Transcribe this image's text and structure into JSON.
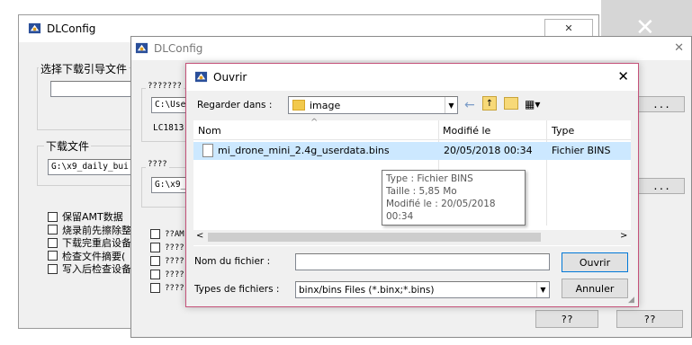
{
  "bg_window1": {
    "title": "DLConfig",
    "group1_label": "选择下载引导文件",
    "group2_label": "下载文件",
    "download_path": "G:\\x9_daily_bui",
    "checkboxes": [
      "保留AMT数据",
      "烧录前先擦除整",
      "下载完重启设备",
      "检查文件摘要(",
      "写入后检查设备"
    ],
    "close_glyph": "✕"
  },
  "bg_window0": {
    "close_glyph": "✕"
  },
  "bg_window2": {
    "title": "DLConfig",
    "group1_label": "???????",
    "path1": "C:\\Use",
    "label_lc": "LC1813",
    "group2_label": "????",
    "path2": "G:\\x9_",
    "checkboxes": [
      "??AM",
      "????",
      "????",
      "????",
      "????"
    ],
    "btn_ellipsis1": "...",
    "btn_ellipsis2": "...",
    "btn_q1": "??",
    "btn_q2": "??",
    "close_glyph": "✕"
  },
  "dialog": {
    "title": "Ouvrir",
    "look_in_label": "Regarder dans :",
    "look_in_value": "image",
    "columns": {
      "name": "Nom",
      "modified": "Modifié le",
      "type": "Type"
    },
    "files": [
      {
        "name": "mi_drone_mini_2.4g_userdata.bins",
        "modified": "20/05/2018 00:34",
        "type": "Fichier BINS"
      }
    ],
    "tooltip": {
      "type": "Type : Fichier BINS",
      "size": "Taille : 5,85 Mo",
      "modified": "Modifié le : 20/05/2018 00:34"
    },
    "filename_label": "Nom du fichier :",
    "filename_value": "",
    "filetype_label": "Types de fichiers :",
    "filetype_value": "binx/bins Files (*.binx;*.bins)",
    "open_button": "Ouvrir",
    "cancel_button": "Annuler",
    "close_glyph": "✕"
  }
}
